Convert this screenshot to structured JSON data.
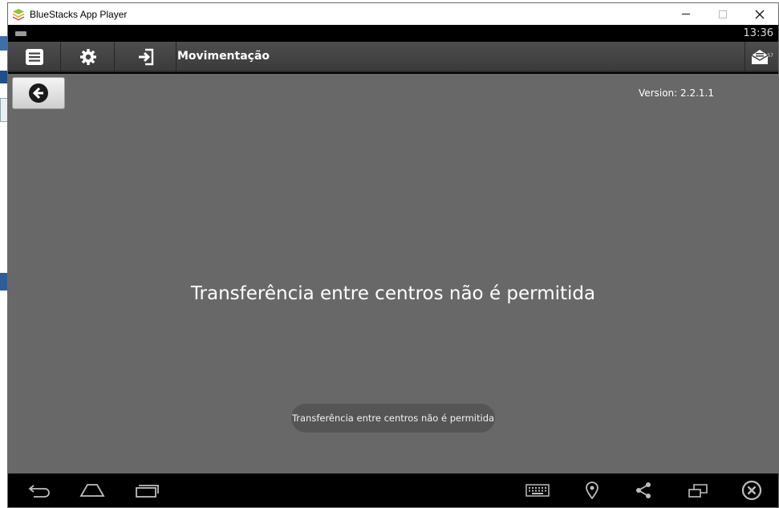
{
  "window": {
    "title": "BlueStacks App Player",
    "controls": {
      "minimize": "minimize",
      "maximize": "maximize",
      "close": "✕"
    }
  },
  "status_bar": {
    "time": "13:36"
  },
  "action_bar": {
    "title": "Movimentação",
    "menu_icon": "list-icon",
    "settings_icon": "gear-icon",
    "exit_icon": "sign-in-icon",
    "messages_icon": "envelope-icon",
    "messages_count": "57"
  },
  "content": {
    "back_icon": "arrow-left-circle-icon",
    "version": "Version: 2.2.1.1",
    "message": "Transferência entre centros não é permitida",
    "toast": "Transferência entre centros não é permitida"
  },
  "nav_bar": {
    "back_icon": "back-arrow-icon",
    "home_icon": "home-icon",
    "recents_icon": "recent-apps-icon",
    "keyboard_icon": "keyboard-icon",
    "location_icon": "location-pin-icon",
    "share_icon": "share-icon",
    "window_icon": "window-resize-icon",
    "close_icon": "close-circle-icon"
  },
  "colors": {
    "content_bg": "#686868",
    "action_bar_bg": "#444444",
    "toast_bg": "#555555",
    "nav_bg": "#000000"
  }
}
